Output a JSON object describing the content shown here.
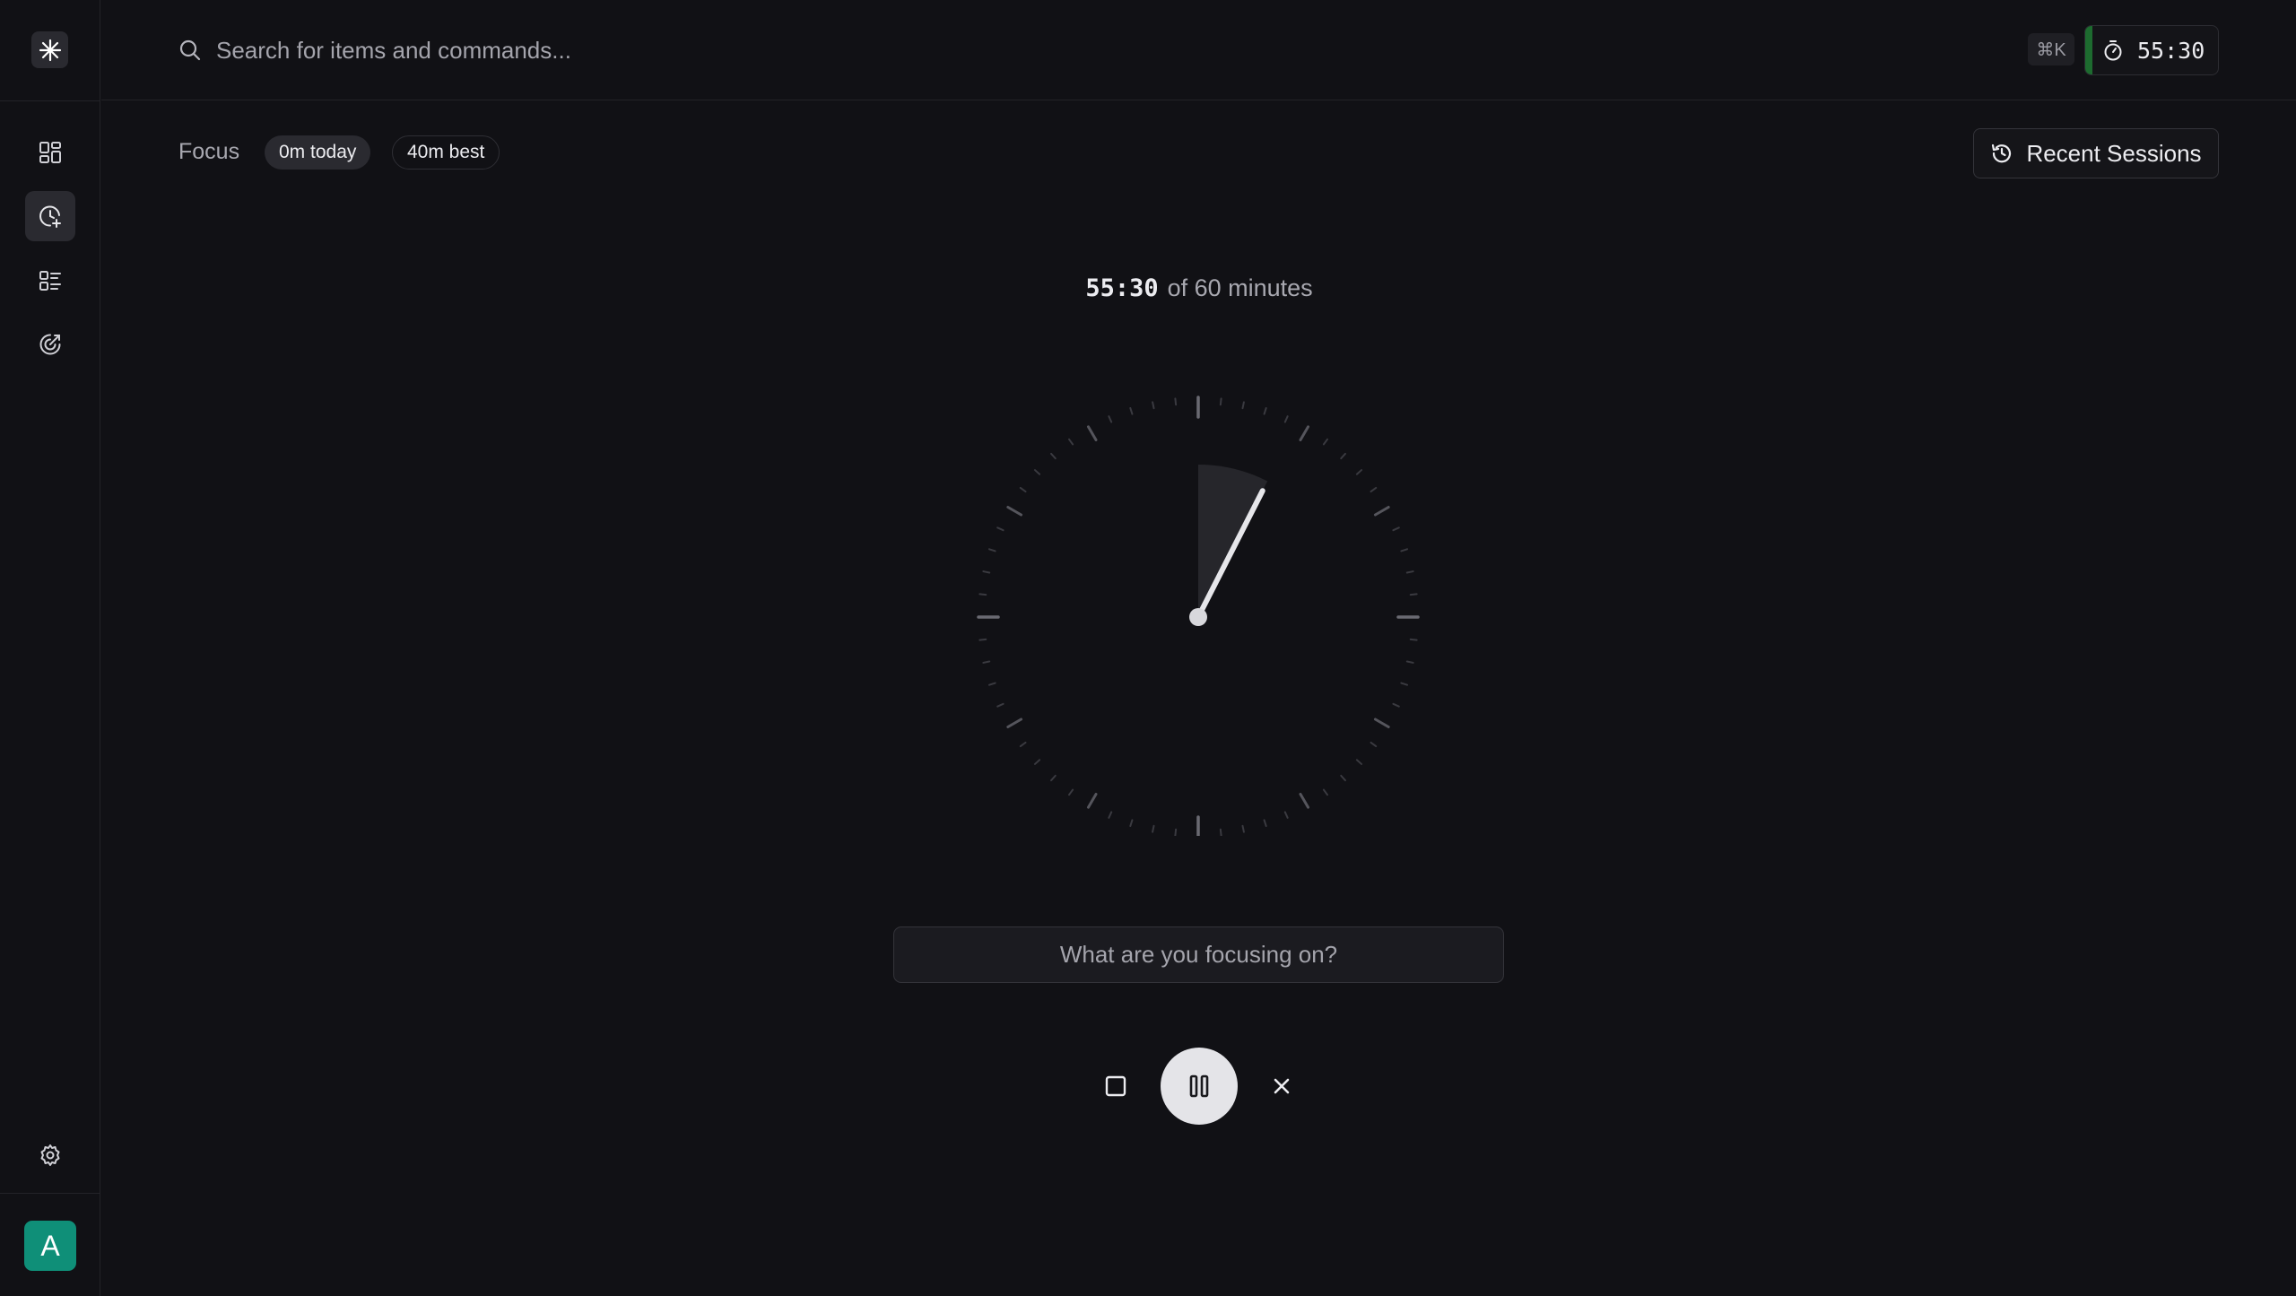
{
  "search": {
    "placeholder": "Search for items and commands..."
  },
  "shortcut": "⌘K",
  "timer_chip": {
    "time": "55:30",
    "accent": "#1d6b2f"
  },
  "sidebar": {
    "items": [
      {
        "name": "dashboard",
        "icon": "dashboard-grid-icon"
      },
      {
        "name": "focus",
        "icon": "clock-plus-icon",
        "active": true
      },
      {
        "name": "tasks",
        "icon": "checklist-icon"
      },
      {
        "name": "stats",
        "icon": "target-chart-icon"
      }
    ],
    "settings_icon": "gear-icon",
    "avatar_letter": "A",
    "avatar_color": "#0f8f78"
  },
  "header": {
    "title": "Focus",
    "today_badge": "0m today",
    "best_badge": "40m best",
    "recent_label": "Recent Sessions"
  },
  "session": {
    "current": "55:30",
    "total_text": "of 60 minutes",
    "elapsed_minutes": 4.5,
    "remaining_minutes": 55.5,
    "total_minutes": 60
  },
  "intent": {
    "placeholder": "What are you focusing on?",
    "value": ""
  },
  "controls": {
    "stop": "stop-square-icon",
    "pause": "pause-icon",
    "cancel": "close-icon"
  }
}
